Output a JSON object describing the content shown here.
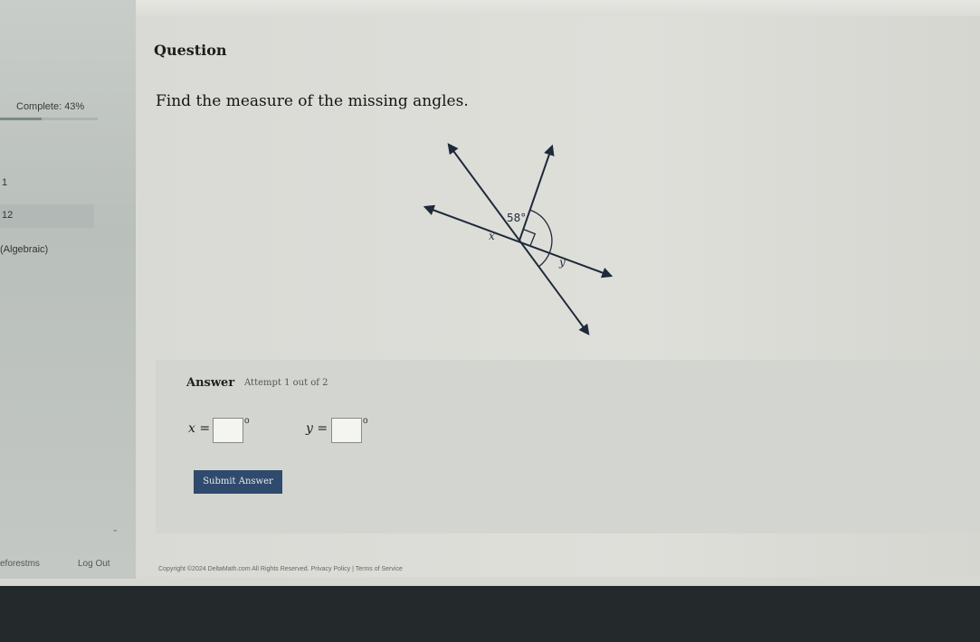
{
  "sidebar": {
    "progress_label": "Complete: 43%",
    "progress_fraction": 0.43,
    "item_number_1": "1",
    "item_number_2": "12",
    "topic_label": "(Algebraic)",
    "footer_forms": "eforestms",
    "footer_logout": "Log Out"
  },
  "question": {
    "heading": "Question",
    "prompt": "Find the measure of the missing angles."
  },
  "figure": {
    "labels": {
      "angle_given": "58°",
      "angle_x": "x",
      "angle_y": "y"
    }
  },
  "answer": {
    "heading": "Answer",
    "attempt": "Attempt 1 out of 2",
    "x_label": "x =",
    "y_label": "y =",
    "x_value": "",
    "y_value": "",
    "degree_symbol": "o",
    "submit_label": "Submit Answer"
  },
  "footer": {
    "copyright": "Copyright ©2024 DeltaMath.com All Rights Reserved.   Privacy Policy | Terms of Service"
  },
  "colors": {
    "submit_button": "#2f4a6c",
    "bottom_bar": "#24292b"
  }
}
